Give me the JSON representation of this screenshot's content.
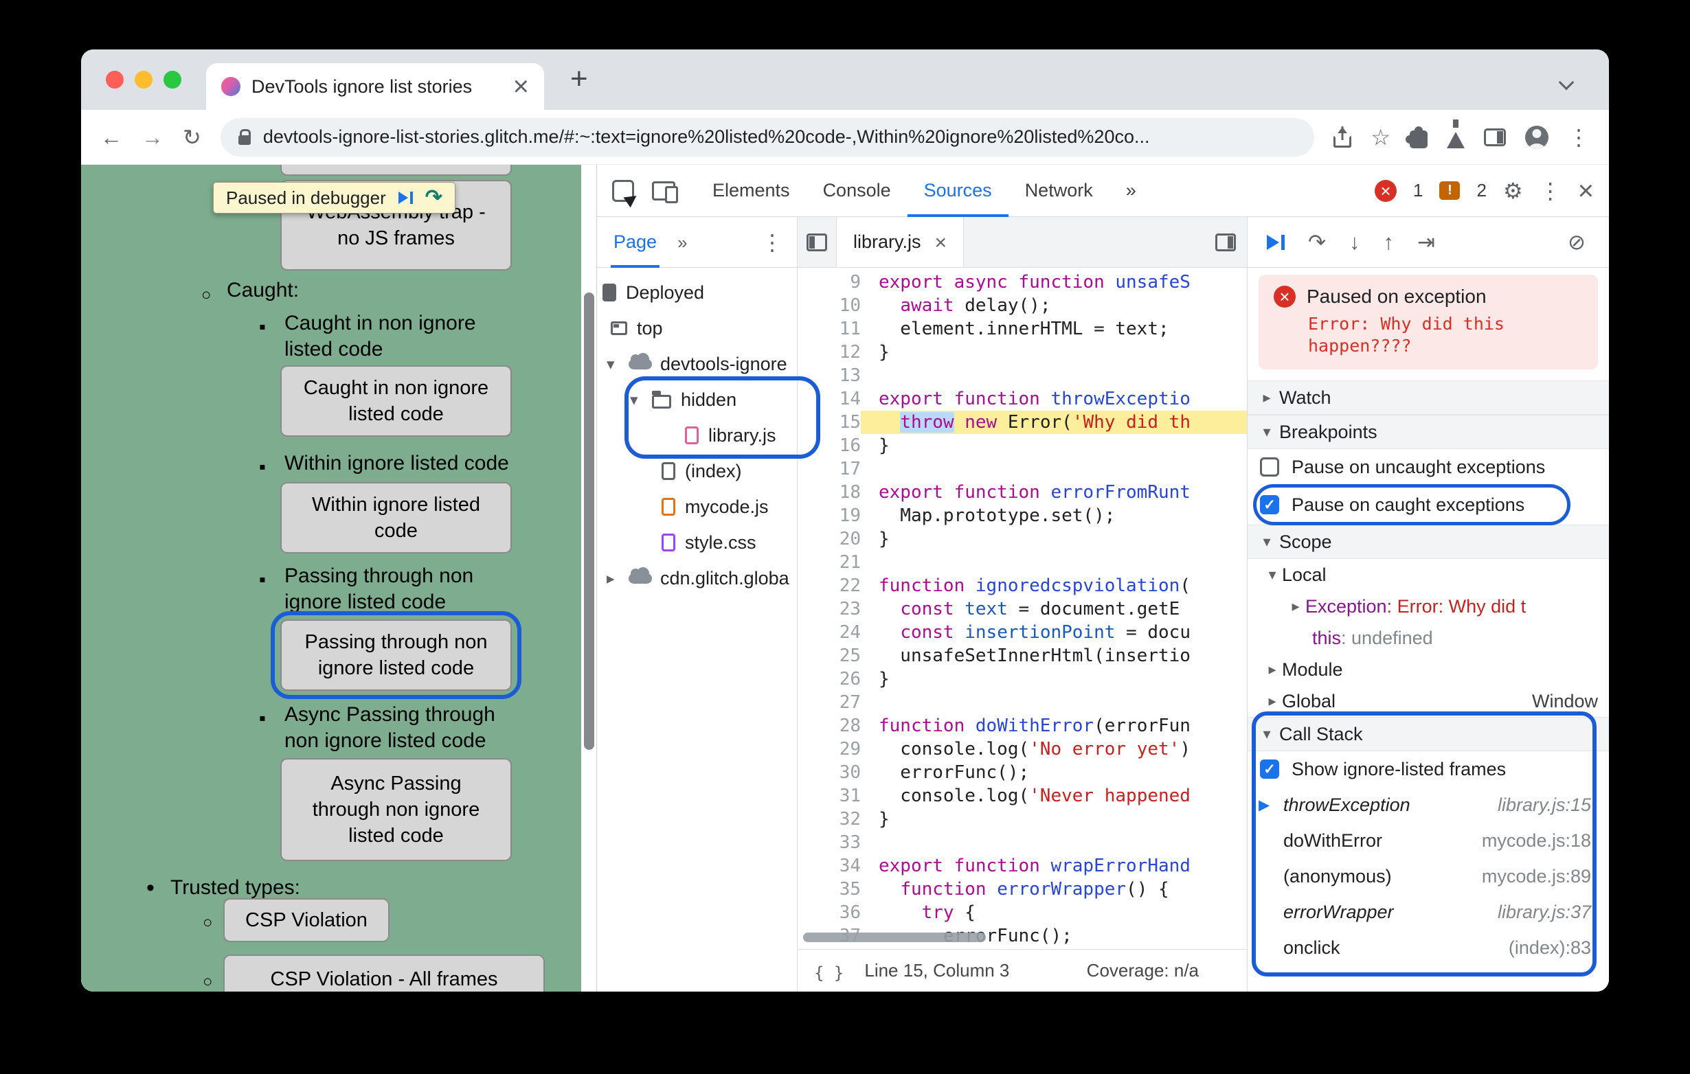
{
  "window": {
    "tab_title": "DevTools ignore list stories",
    "url": "devtools-ignore-list-stories.glitch.me/#:~:text=ignore%20listed%20code-,Within%20ignore%20listed%20co..."
  },
  "page": {
    "debugger_banner": "Paused in debugger",
    "wasm_button": "WebAssembly trap -\nno JS frames",
    "caught_heading": "Caught:",
    "caught_label": "Caught in non ignore\nlisted code",
    "caught_button": "Caught in non ignore\nlisted code",
    "within_label": "Within ignore listed code",
    "within_button": "Within ignore listed\ncode",
    "passing_label": "Passing through non\nignore listed code",
    "passing_button": "Passing through non\nignore listed code",
    "async_label": "Async Passing through\nnon ignore listed code",
    "async_button": "Async Passing\nthrough non ignore\nlisted code",
    "trusted_heading": "Trusted types:",
    "csp_button": "CSP Violation",
    "csp_all_frames_button": "CSP Violation - All frames"
  },
  "devtools": {
    "tabs": {
      "elements": "Elements",
      "console": "Console",
      "sources": "Sources",
      "network": "Network"
    },
    "error_count": "1",
    "issues_count": "2",
    "navigator": {
      "tab_label": "Page",
      "tree": [
        {
          "label": "Deployed"
        },
        {
          "label": "top"
        },
        {
          "label": "devtools-ignore"
        },
        {
          "label": "hidden"
        },
        {
          "label": "library.js"
        },
        {
          "label": "(index)"
        },
        {
          "label": "mycode.js"
        },
        {
          "label": "style.css"
        },
        {
          "label": "cdn.glitch.globa"
        }
      ]
    },
    "editor": {
      "tab_label": "library.js",
      "status_position": "Line 15, Column 3",
      "status_coverage": "Coverage: n/a",
      "lines": [
        {
          "n": "9",
          "s": [
            [
              "export async function ",
              "kw"
            ],
            [
              "unsafeS",
              "fn"
            ]
          ]
        },
        {
          "n": "10",
          "s": [
            [
              "  ",
              "pl"
            ],
            [
              "await",
              "kw"
            ],
            [
              " delay();",
              "pl"
            ]
          ]
        },
        {
          "n": "11",
          "s": [
            [
              "  element.innerHTML = text;",
              "pl"
            ]
          ]
        },
        {
          "n": "12",
          "s": [
            [
              "}",
              "pl"
            ]
          ]
        },
        {
          "n": "13",
          "s": []
        },
        {
          "n": "14",
          "s": [
            [
              "export function ",
              "kw"
            ],
            [
              "throwExceptio",
              "fn"
            ]
          ]
        },
        {
          "n": "15",
          "hl": true,
          "s": [
            [
              "  ",
              "pl"
            ],
            [
              "throw",
              "kw sel"
            ],
            [
              " ",
              "pl"
            ],
            [
              "new",
              "kw"
            ],
            [
              " Error(",
              "pl"
            ],
            [
              "'Why did th",
              "str"
            ]
          ]
        },
        {
          "n": "16",
          "s": [
            [
              "}",
              "pl"
            ]
          ]
        },
        {
          "n": "17",
          "s": []
        },
        {
          "n": "18",
          "s": [
            [
              "export function ",
              "kw"
            ],
            [
              "errorFromRunt",
              "fn"
            ]
          ]
        },
        {
          "n": "19",
          "s": [
            [
              "  Map.prototype.set();",
              "pl"
            ]
          ]
        },
        {
          "n": "20",
          "s": [
            [
              "}",
              "pl"
            ]
          ]
        },
        {
          "n": "21",
          "s": []
        },
        {
          "n": "22",
          "s": [
            [
              "function ",
              "kw"
            ],
            [
              "ignoredcspviolation",
              "fn"
            ],
            [
              "(",
              "pl"
            ]
          ]
        },
        {
          "n": "23",
          "s": [
            [
              "  ",
              "pl"
            ],
            [
              "const",
              "kw"
            ],
            [
              " ",
              "pl"
            ],
            [
              "text",
              "vr"
            ],
            [
              " = document.getE",
              "pl"
            ]
          ]
        },
        {
          "n": "24",
          "s": [
            [
              "  ",
              "pl"
            ],
            [
              "const",
              "kw"
            ],
            [
              " ",
              "pl"
            ],
            [
              "insertionPoint",
              "vr"
            ],
            [
              " = docu",
              "pl"
            ]
          ]
        },
        {
          "n": "25",
          "s": [
            [
              "  unsafeSetInnerHtml(insertio",
              "pl"
            ]
          ]
        },
        {
          "n": "26",
          "s": [
            [
              "}",
              "pl"
            ]
          ]
        },
        {
          "n": "27",
          "s": []
        },
        {
          "n": "28",
          "s": [
            [
              "function ",
              "kw"
            ],
            [
              "doWithError",
              "fn"
            ],
            [
              "(errorFun",
              "pl"
            ]
          ]
        },
        {
          "n": "29",
          "s": [
            [
              "  console.log(",
              "pl"
            ],
            [
              "'No error yet'",
              "str"
            ],
            [
              ")",
              "pl"
            ]
          ]
        },
        {
          "n": "30",
          "s": [
            [
              "  errorFunc();",
              "pl"
            ]
          ]
        },
        {
          "n": "31",
          "s": [
            [
              "  console.log(",
              "pl"
            ],
            [
              "'Never happened",
              "str"
            ]
          ]
        },
        {
          "n": "32",
          "s": [
            [
              "}",
              "pl"
            ]
          ]
        },
        {
          "n": "33",
          "s": []
        },
        {
          "n": "34",
          "s": [
            [
              "export function ",
              "kw"
            ],
            [
              "wrapErrorHand",
              "fn"
            ]
          ]
        },
        {
          "n": "35",
          "s": [
            [
              "  ",
              "pl"
            ],
            [
              "function",
              "kw"
            ],
            [
              " ",
              "pl"
            ],
            [
              "errorWrapper",
              "fn"
            ],
            [
              "() {",
              "pl"
            ]
          ]
        },
        {
          "n": "36",
          "s": [
            [
              "    ",
              "pl"
            ],
            [
              "try",
              "kw"
            ],
            [
              " {",
              "pl"
            ]
          ]
        },
        {
          "n": "37",
          "s": [
            [
              "      errorFunc();",
              "pl"
            ]
          ]
        }
      ]
    },
    "debugger": {
      "paused_title": "Paused on exception",
      "paused_message": "Error: Why did this\nhappen????",
      "watch_label": "Watch",
      "breakpoints_label": "Breakpoints",
      "pause_uncaught_label": "Pause on uncaught exceptions",
      "pause_caught_label": "Pause on caught exceptions",
      "scope_label": "Scope",
      "local_label": "Local",
      "exception_name": "Exception",
      "exception_value": ": Error: Why did t",
      "this_name": "this",
      "this_value": ": undefined",
      "module_label": "Module",
      "global_label": "Global",
      "global_value": "Window",
      "call_stack_label": "Call Stack",
      "show_ignore_label": "Show ignore-listed frames",
      "frames": [
        {
          "name": "throwException",
          "loc": "library.js:15"
        },
        {
          "name": "doWithError",
          "loc": "mycode.js:18"
        },
        {
          "name": "(anonymous)",
          "loc": "mycode.js:89"
        },
        {
          "name": "errorWrapper",
          "loc": "library.js:37"
        },
        {
          "name": "onclick",
          "loc": "(index):83"
        }
      ]
    }
  }
}
